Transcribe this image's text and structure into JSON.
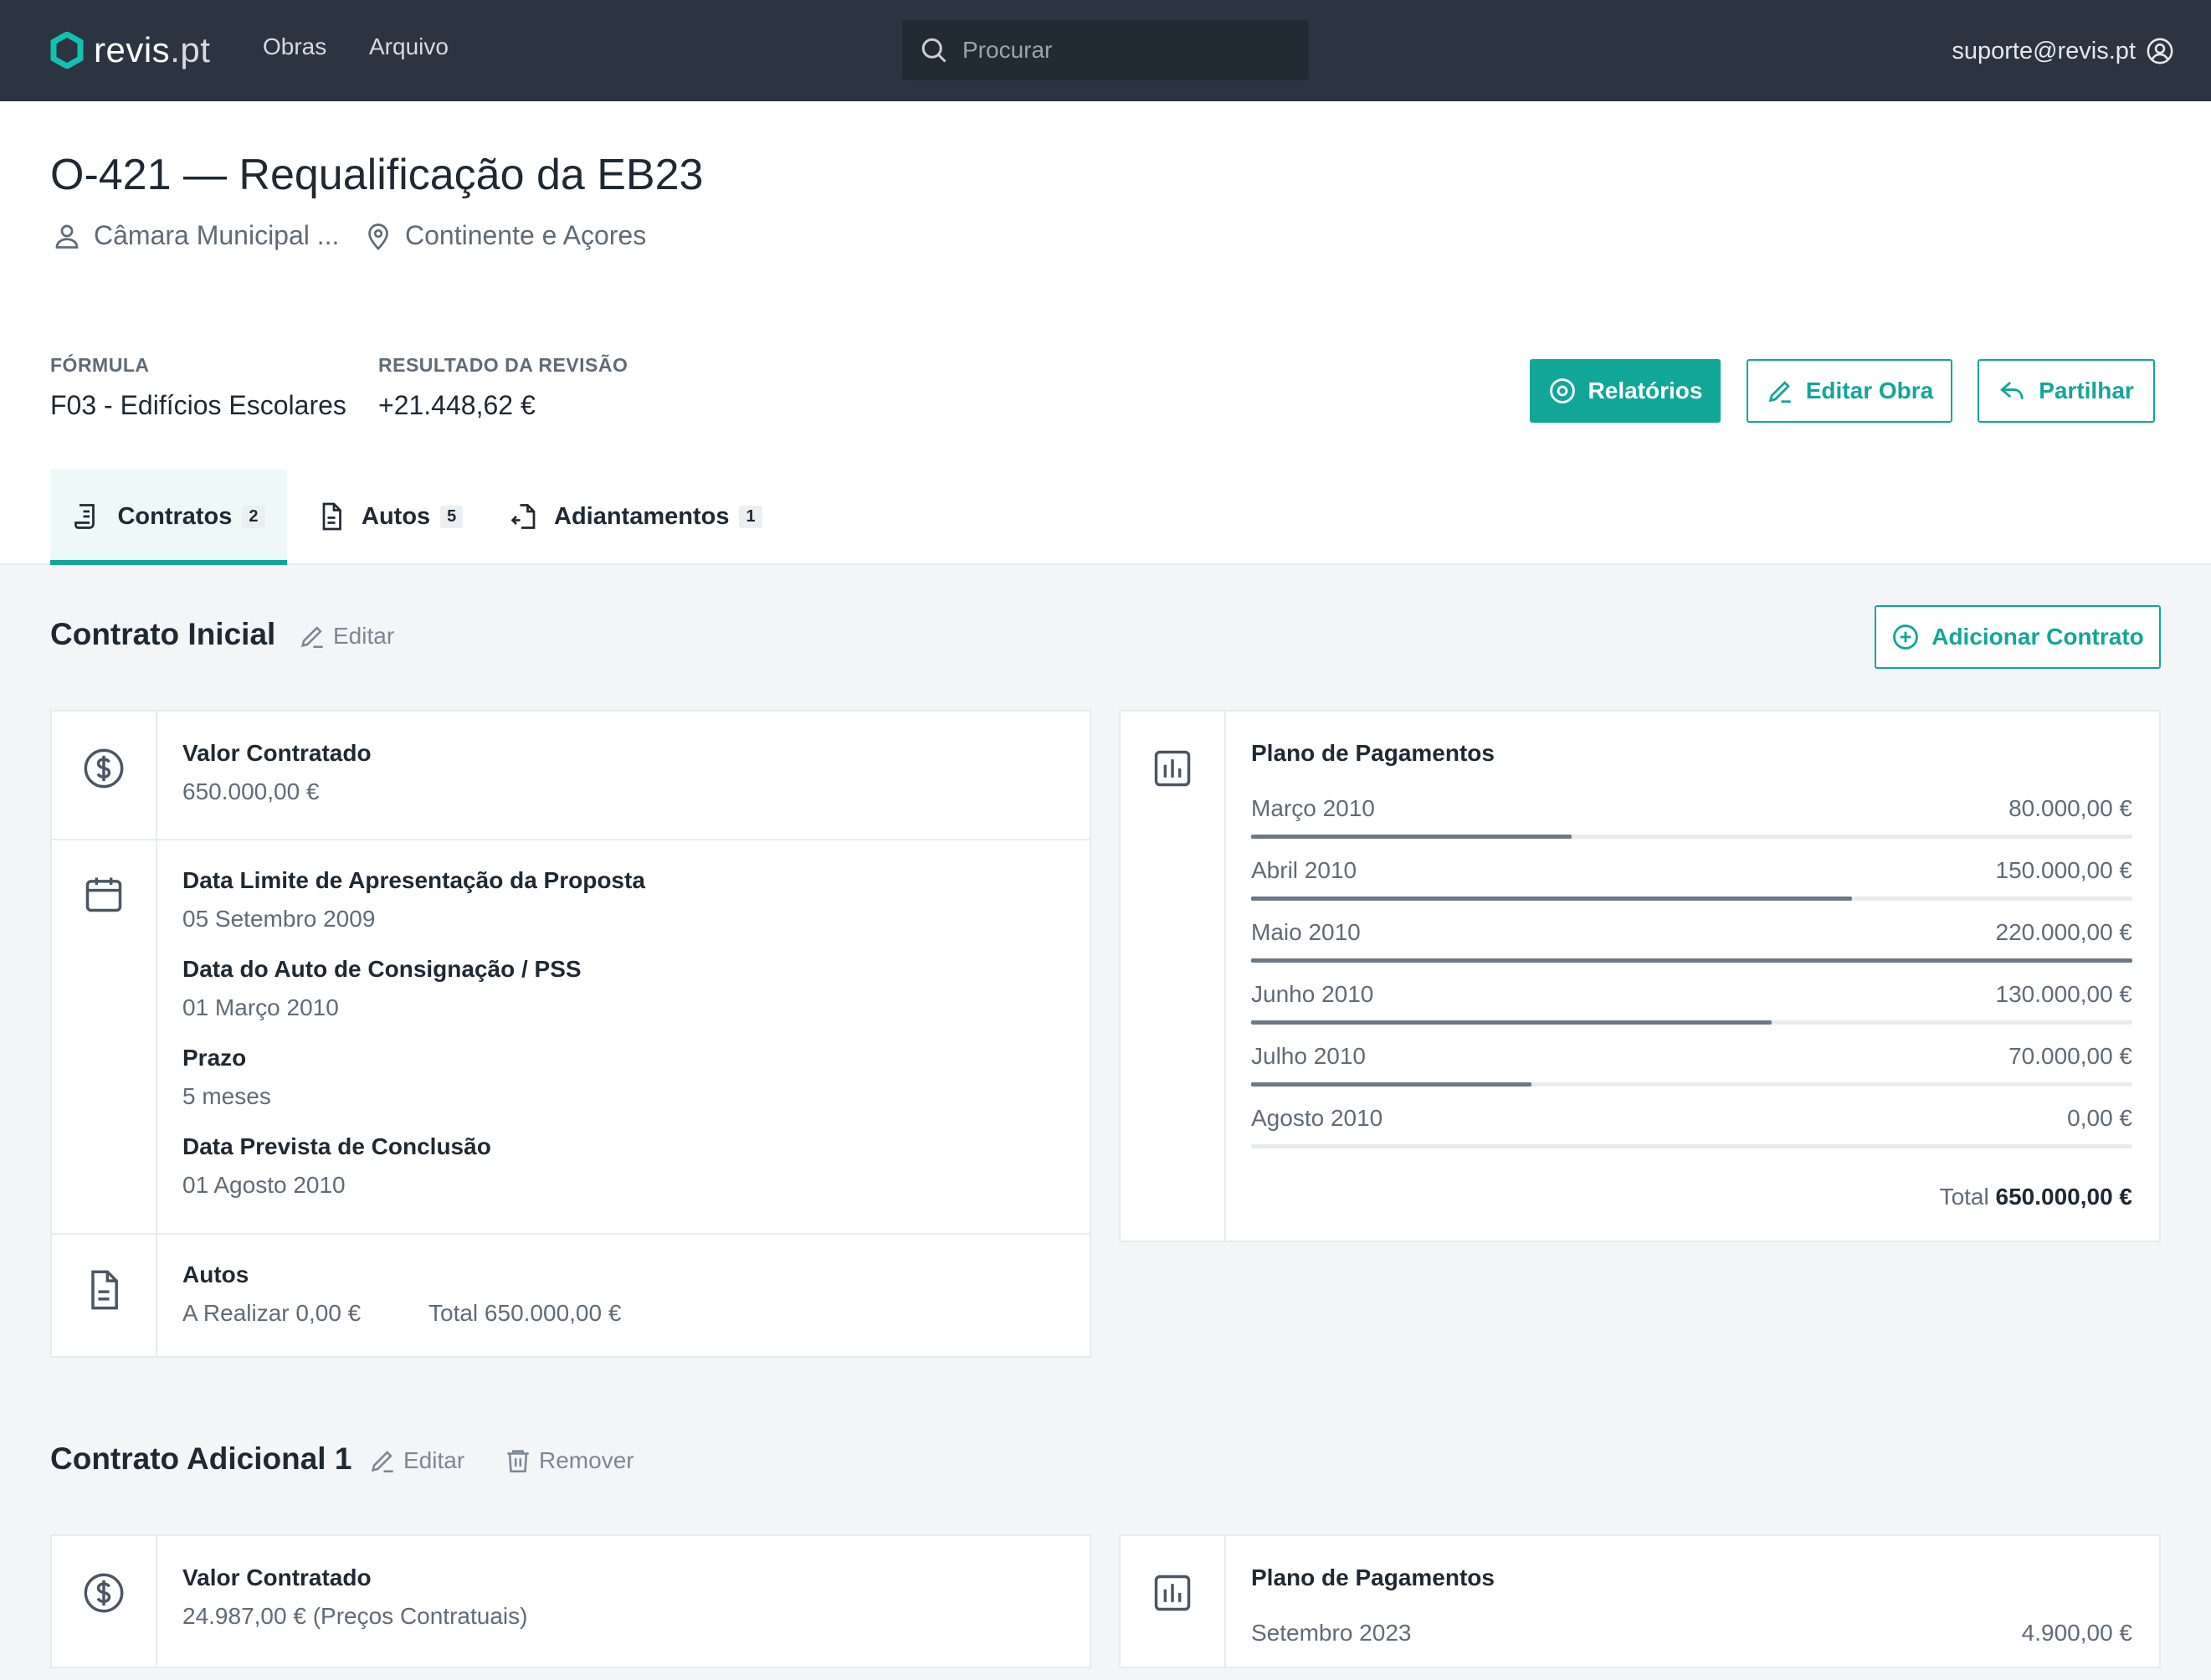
{
  "nav": {
    "logo_main": "revis",
    "logo_suffix": ".pt",
    "links": [
      "Obras",
      "Arquivo"
    ],
    "search_placeholder": "Procurar",
    "user_email": "suporte@revis.pt"
  },
  "obra": {
    "title": "O-421 — Requalificação da EB23",
    "client": "Câmara Municipal ...",
    "region": "Continente e Açores"
  },
  "summary": {
    "formula_label": "FÓRMULA",
    "formula_value": "F03 - Edifícios Escolares",
    "result_label": "RESULTADO DA REVISÃO",
    "result_value": "+21.448,62 €",
    "btn_reports": "Relatórios",
    "btn_edit": "Editar Obra",
    "btn_share": "Partilhar"
  },
  "tabs": [
    {
      "label": "Contratos",
      "count": "2"
    },
    {
      "label": "Autos",
      "count": "5"
    },
    {
      "label": "Adiantamentos",
      "count": "1"
    }
  ],
  "colors": {
    "accent": "#12a699",
    "topbar": "#2b3440",
    "progress": "#6b7886"
  },
  "contrato_inicial": {
    "title": "Contrato Inicial",
    "edit_label": "Editar",
    "add_contract_label": "Adicionar Contrato",
    "valor_label": "Valor Contratado",
    "valor_value": "650.000,00 €",
    "data_limite_label": "Data Limite de Apresentação da Proposta",
    "data_limite_value": "05 Setembro 2009",
    "data_auto_label": "Data do Auto de Consignação / PSS",
    "data_auto_value": "01 Março 2010",
    "prazo_label": "Prazo",
    "prazo_value": "5 meses",
    "data_prevista_label": "Data Prevista de Conclusão",
    "data_prevista_value": "01 Agosto 2010",
    "autos_label": "Autos",
    "autos_a_realizar": "A Realizar 0,00 €",
    "autos_total": "Total 650.000,00 €",
    "plano_title": "Plano de Pagamentos",
    "plano": [
      {
        "month": "Março 2010",
        "amount": "80.000,00 €",
        "fraction": 0.364
      },
      {
        "month": "Abril 2010",
        "amount": "150.000,00 €",
        "fraction": 0.682
      },
      {
        "month": "Maio 2010",
        "amount": "220.000,00 €",
        "fraction": 1.0
      },
      {
        "month": "Junho 2010",
        "amount": "130.000,00 €",
        "fraction": 0.591
      },
      {
        "month": "Julho 2010",
        "amount": "70.000,00 €",
        "fraction": 0.318
      },
      {
        "month": "Agosto 2010",
        "amount": "0,00 €",
        "fraction": 0.0
      }
    ],
    "plano_total_label": "Total",
    "plano_total_value": "650.000,00 €"
  },
  "contrato_adicional": {
    "title": "Contrato Adicional 1",
    "edit_label": "Editar",
    "remove_label": "Remover",
    "valor_label": "Valor Contratado",
    "valor_value": "24.987,00 € (Preços Contratuais)",
    "plano_title": "Plano de Pagamentos",
    "plano": [
      {
        "month": "Setembro 2023",
        "amount": "4.900,00 €"
      }
    ]
  }
}
